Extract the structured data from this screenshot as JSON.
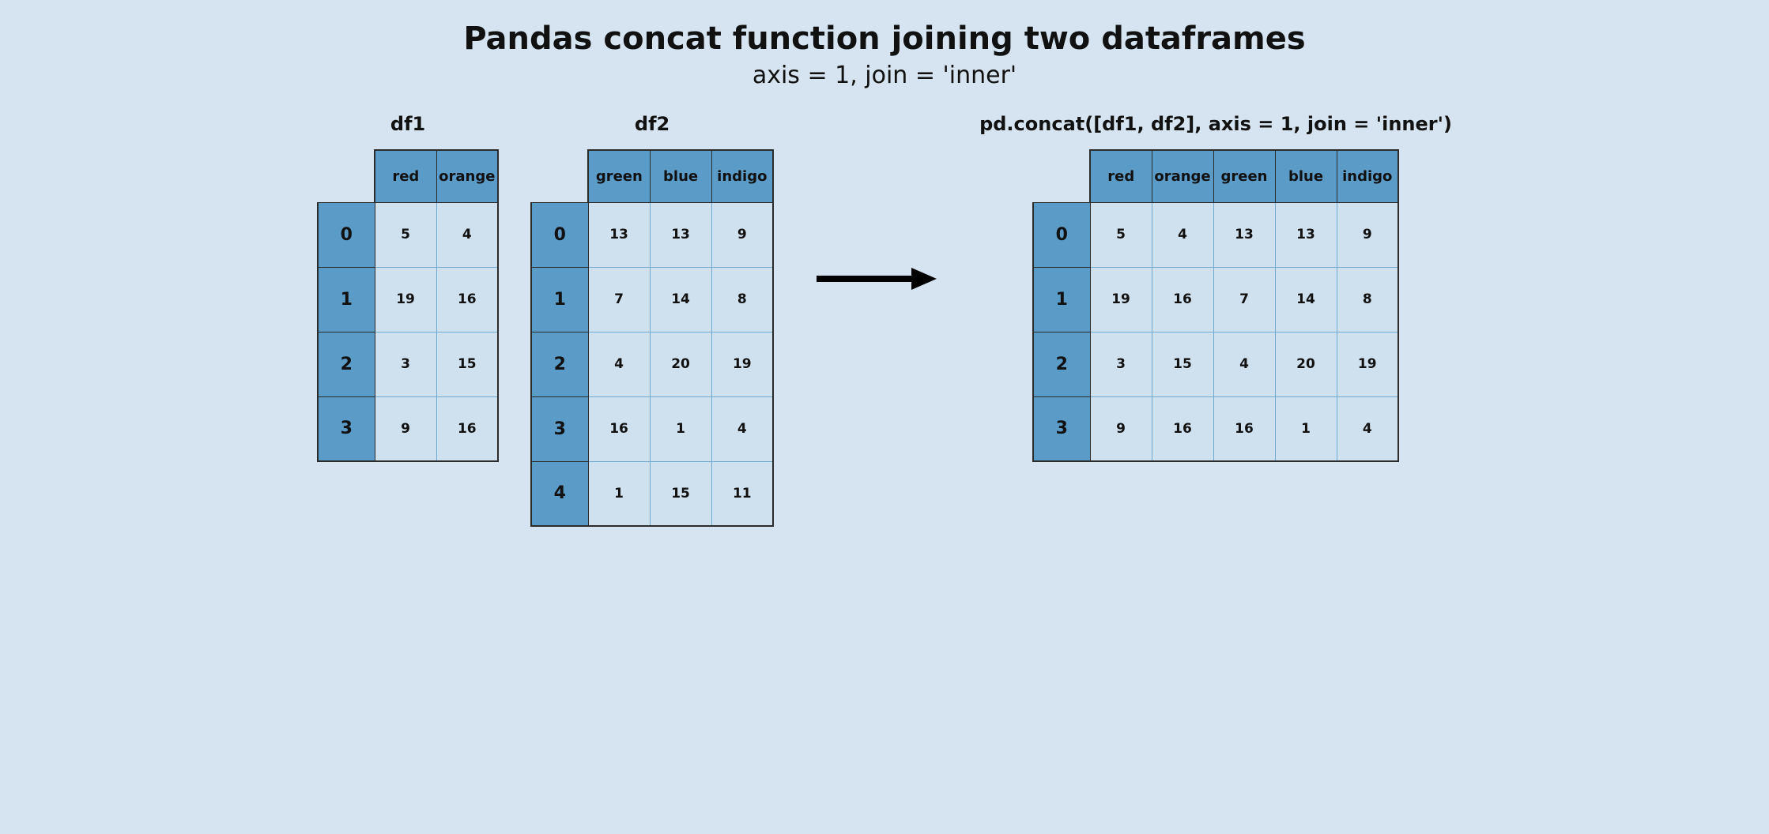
{
  "title": "Pandas concat function joining two dataframes",
  "subtitle": "axis = 1, join = 'inner'",
  "labels": {
    "df1": "df1",
    "df2": "df2",
    "result": "pd.concat([df1, df2], axis = 1, join = 'inner')"
  },
  "chart_data": {
    "type": "table",
    "df1": {
      "columns": [
        "red",
        "orange"
      ],
      "index": [
        0,
        1,
        2,
        3
      ],
      "rows": [
        [
          5,
          4
        ],
        [
          19,
          16
        ],
        [
          3,
          15
        ],
        [
          9,
          16
        ]
      ]
    },
    "df2": {
      "columns": [
        "green",
        "blue",
        "indigo"
      ],
      "index": [
        0,
        1,
        2,
        3,
        4
      ],
      "rows": [
        [
          13,
          13,
          9
        ],
        [
          7,
          14,
          8
        ],
        [
          4,
          20,
          19
        ],
        [
          16,
          1,
          4
        ],
        [
          1,
          15,
          11
        ]
      ]
    },
    "result": {
      "columns": [
        "red",
        "orange",
        "green",
        "blue",
        "indigo"
      ],
      "index": [
        0,
        1,
        2,
        3
      ],
      "rows": [
        [
          5,
          4,
          13,
          13,
          9
        ],
        [
          19,
          16,
          7,
          14,
          8
        ],
        [
          3,
          15,
          4,
          20,
          19
        ],
        [
          9,
          16,
          16,
          1,
          4
        ]
      ]
    }
  }
}
